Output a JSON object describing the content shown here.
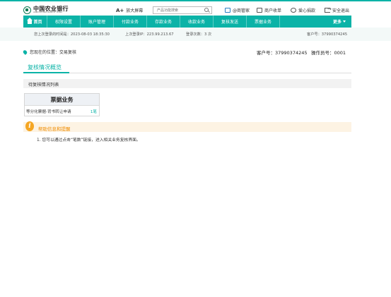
{
  "brand": {
    "name_cn": "中国农业银行",
    "name_en": "AGRICULTURAL BANK OF CHINA"
  },
  "header": {
    "font_toggle_symbol": "A+",
    "font_toggle_label": "放大屏幕",
    "search_placeholder": "产品功能搜索",
    "links": [
      {
        "label": "@商管家",
        "icon": "inbox-icon"
      },
      {
        "label": "商户收单",
        "icon": "card-icon"
      },
      {
        "label": "爱心捐款",
        "icon": "heart-icon"
      },
      {
        "label": "安全退出",
        "icon": "exit-icon"
      }
    ]
  },
  "nav": {
    "home": "首页",
    "items": [
      "权限设置",
      "账户管理",
      "付款业务",
      "存款业务",
      "收款业务",
      "复核发送",
      "票据业务"
    ],
    "more": "更多"
  },
  "login_info": {
    "last_login_time": "您上次登录的时间是：2023-08-03 18:35:30",
    "last_login_ip": "上次登录IP：223.99.213.67",
    "login_count": "登录次数：3 次",
    "customer_no": "客户号：37990374245"
  },
  "location": {
    "label": "您现在的位置：",
    "page": "交易复核"
  },
  "account": {
    "customer": "客户号：37990374245",
    "operator": "操作员号：0001"
  },
  "section": {
    "title": "复核情况概览",
    "list_title": "待复核情况列表"
  },
  "card": {
    "title": "票据业务",
    "row_label": "等分化票据-背书转让申请",
    "row_count": "1笔"
  },
  "help": {
    "icon_char": "i",
    "title": "帮助信息和提醒",
    "lines": [
      "1. 您可以通过点击“笔数”链接，进入相关业务复核界面。"
    ]
  },
  "colors": {
    "accent": "#0bb3a7",
    "help_orange": "#f5a623",
    "help_bg": "#fdf3e3"
  }
}
